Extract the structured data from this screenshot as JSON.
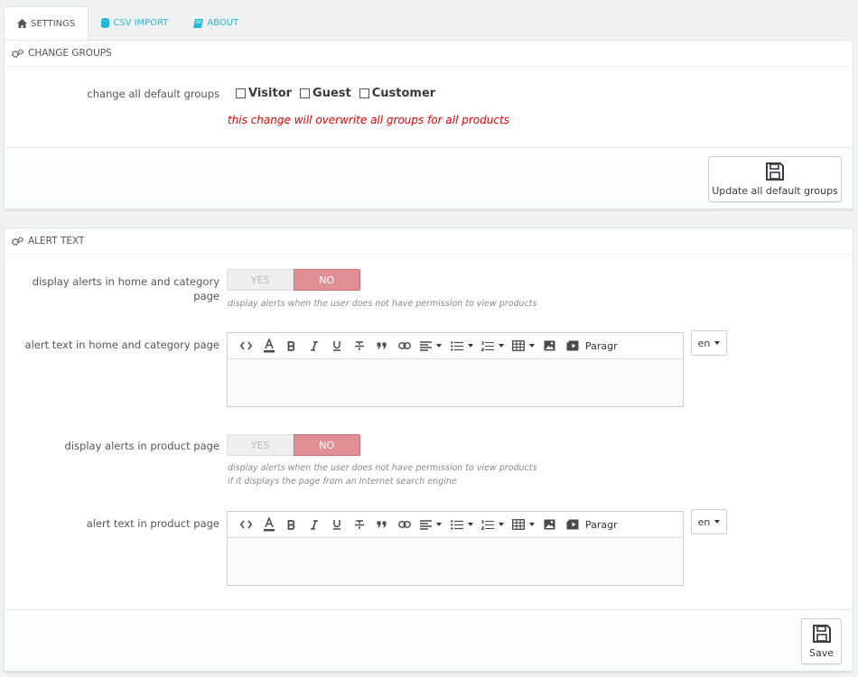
{
  "tabs": [
    {
      "label": "Settings",
      "icon": "home-icon"
    },
    {
      "label": "CSV import",
      "icon": "database-icon"
    },
    {
      "label": "About",
      "icon": "book-icon"
    }
  ],
  "change_groups": {
    "title": "Change groups",
    "label": "change all default groups",
    "groups": [
      "Visitor",
      "Guest",
      "Customer"
    ],
    "warning": "this change will overwrite all groups for all products",
    "button_label": "Update all default groups"
  },
  "alert_text": {
    "title": "Alert text",
    "home_display": {
      "label": "display alerts in home and category page",
      "yes": "YES",
      "no": "NO",
      "help": "display alerts when the user does not have permission to view products"
    },
    "home_text": {
      "label": "alert text in home and category page"
    },
    "product_display": {
      "label": "display alerts in product page",
      "yes": "YES",
      "no": "NO",
      "help_line1": "display alerts when the user does not have permission to view products",
      "help_line2": "if it displays the page from an Internet search engine"
    },
    "product_text": {
      "label": "alert text in product page"
    },
    "save_label": "Save"
  },
  "editor": {
    "paragraph": "Paragraph",
    "language": "en"
  },
  "colors": {
    "accent": "#25b9d7",
    "no_active": "#e08f95",
    "warning": "#e60000"
  }
}
